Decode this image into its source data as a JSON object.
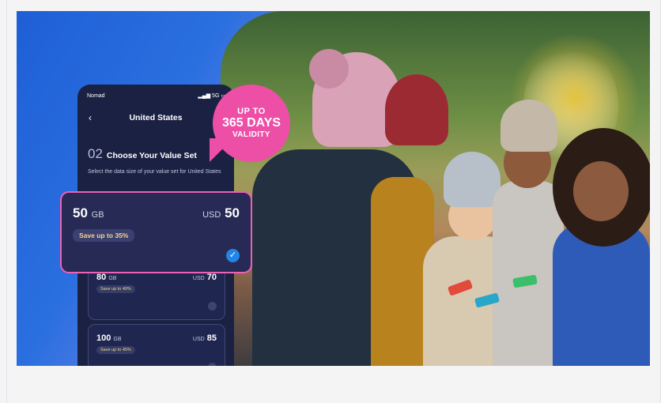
{
  "promo_badge": {
    "line1": "UP TO",
    "line2": "365 DAYS",
    "line3": "VALIDITY",
    "color": "#ed4fa7"
  },
  "phone": {
    "carrier": "Nomad",
    "network": "5G",
    "title": "United States",
    "step_number": "02",
    "step_title": "Choose Your Value Set",
    "step_description": "Select the data size of your value set for United States"
  },
  "selected_plan": {
    "size": "50",
    "unit": "GB",
    "currency": "USD",
    "price": "50",
    "save": "Save up to 35%"
  },
  "plans": [
    {
      "size": "80",
      "unit": "GB",
      "currency": "USD",
      "price": "70",
      "save": "Save up to 40%"
    },
    {
      "size": "100",
      "unit": "GB",
      "currency": "USD",
      "price": "85",
      "save": "Save up to 45%"
    }
  ],
  "colors": {
    "accent_pink": "#ef5fb4",
    "phone_bg": "#1b2143",
    "check_blue": "#2385e8"
  }
}
